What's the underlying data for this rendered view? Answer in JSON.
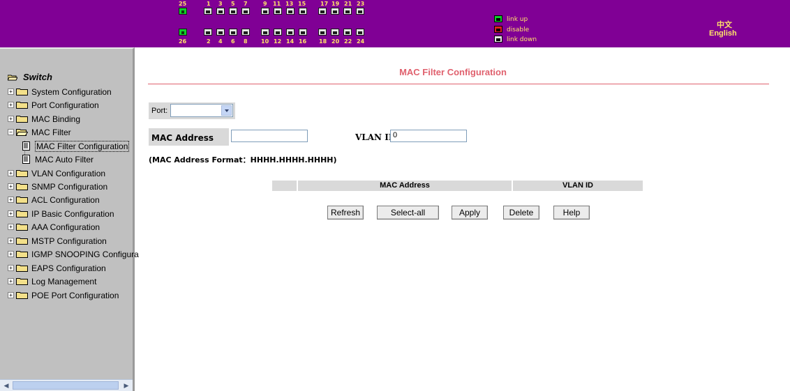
{
  "banner": {
    "top_ports": [
      "25",
      "1",
      "3",
      "5",
      "7",
      "9",
      "11",
      "13",
      "15",
      "17",
      "19",
      "21",
      "23"
    ],
    "bottom_ports": [
      "26",
      "2",
      "4",
      "6",
      "8",
      "10",
      "12",
      "14",
      "16",
      "18",
      "20",
      "22",
      "24"
    ],
    "legend": {
      "link_up": "link up",
      "disable": "disable",
      "link_down": "link down",
      "link_up_color": "#0fd02a",
      "disable_color": "#e02020",
      "link_down_color": "#e6e6e6"
    },
    "lang_chinese": "中文",
    "lang_english": "English",
    "banner_color": "#800095",
    "text_color": "#ffe36a"
  },
  "sidebar": {
    "root": "Switch",
    "items": [
      {
        "label": "System Configuration"
      },
      {
        "label": "Port Configuration"
      },
      {
        "label": "MAC Binding"
      },
      {
        "label": "MAC Filter"
      },
      {
        "label": "MAC Filter Configuration"
      },
      {
        "label": "MAC Auto Filter"
      },
      {
        "label": "VLAN Configuration"
      },
      {
        "label": "SNMP Configuration"
      },
      {
        "label": "ACL Configuration"
      },
      {
        "label": "IP Basic Configuration"
      },
      {
        "label": "AAA Configuration"
      },
      {
        "label": "MSTP Configuration"
      },
      {
        "label": "IGMP SNOOPING Configura"
      },
      {
        "label": "EAPS Configuration"
      },
      {
        "label": "Log Management"
      },
      {
        "label": "POE Port Configuration"
      }
    ]
  },
  "main": {
    "title": "MAC Filter Configuration",
    "title_color": "#e0616e",
    "port_label": "Port:",
    "port_value": "",
    "mac_label": "MAC Address",
    "mac_value": "",
    "vlan_label": "VLAN ID",
    "vlan_value": "0",
    "format_note": "(MAC Address Format：HHHH.HHHH.HHHH)",
    "table_headers": [
      "",
      "MAC Address",
      "VLAN ID"
    ],
    "buttons": {
      "refresh": "Refresh",
      "select_all": "Select-all",
      "apply": "Apply",
      "delete": "Delete",
      "help": "Help"
    }
  }
}
